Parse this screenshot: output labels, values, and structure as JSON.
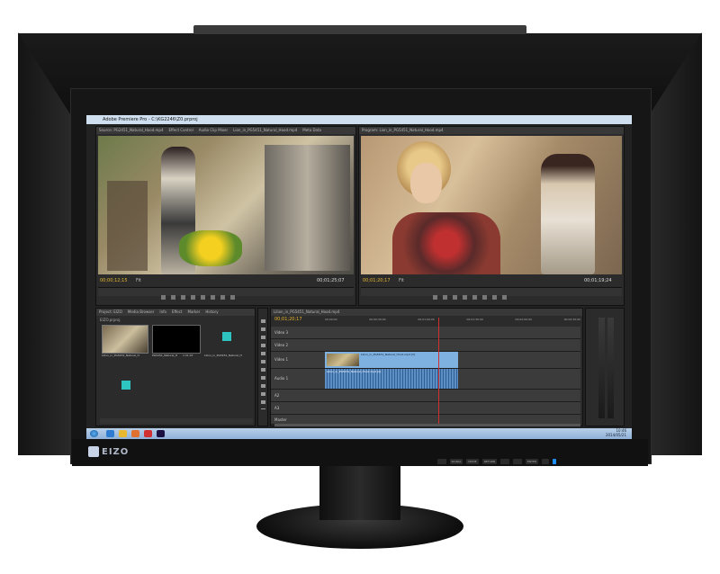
{
  "brand": "EIZO",
  "window": {
    "title": "Adobe Premiere Pro - C:\\KG2246\\Z0.prproj"
  },
  "source_monitor": {
    "tabs": [
      "Source: PG2451_Natural_Hood.mp4",
      "Effect Control",
      "Audio Clip Mixer",
      "Lion_in_PG5451_Natural_Hood.mp4",
      "Meta Data"
    ],
    "timecode_left": "00;00;12;15",
    "fit_label": "Fit",
    "timecode_right": "00;01;25;07"
  },
  "program_monitor": {
    "tabs": [
      "Program: Lion_in_PG5451_Natural_Hood.mp4"
    ],
    "timecode_left": "00;01;20;17",
    "fit_label": "Fit",
    "timecode_right": "00;01;19;24"
  },
  "project_panel": {
    "tabs": [
      "Project: EIZO",
      "Media Browser",
      "Info",
      "Effect",
      "Marker",
      "History"
    ],
    "project_file": "EIZO.prproj",
    "items": [
      {
        "name": "Lilion_in_PG5451_Natural_H"
      },
      {
        "name": "PG5451_Natural_H",
        "duration": "1:31:07"
      },
      {
        "name": "Lilion_in_PG5451_Natural_H"
      }
    ]
  },
  "timeline": {
    "tabs": [
      "Lilion_in_PG5451_Natural_Hood.mp4"
    ],
    "timecode": "00;01;20;17",
    "ruler": [
      "00;00;00",
      "00;00;30;00",
      "00;01;00;00",
      "00;01;30;00",
      "00;02;00;00",
      "00;02;30;00"
    ],
    "tracks": [
      {
        "id": "V3",
        "label": "Video 3"
      },
      {
        "id": "V2",
        "label": "Video 2"
      },
      {
        "id": "V1",
        "label": "Video 1"
      },
      {
        "id": "A1",
        "label": "Audio 1"
      },
      {
        "id": "A2",
        "label": "A2"
      },
      {
        "id": "A3",
        "label": "A3"
      },
      {
        "id": "Master",
        "label": "Master"
      }
    ],
    "video_clip_label": "Lilion_in_PG5451_Natural_Hood.mp4 [V]",
    "audio_clip_label": "Lilion_in_PG5451_Natural_Hood.mp4 [A]"
  },
  "taskbar": {
    "clock_time": "10:46",
    "clock_date": "2014/05/21"
  },
  "osd_buttons": [
    "SIGNAL",
    "MODE",
    "RETURN",
    "",
    "",
    "ENTER"
  ],
  "colors": {
    "timecode": "#e8b830",
    "clip_video": "#7fb1e0",
    "clip_audio": "#5d8fc4",
    "playhead": "#d03030"
  }
}
